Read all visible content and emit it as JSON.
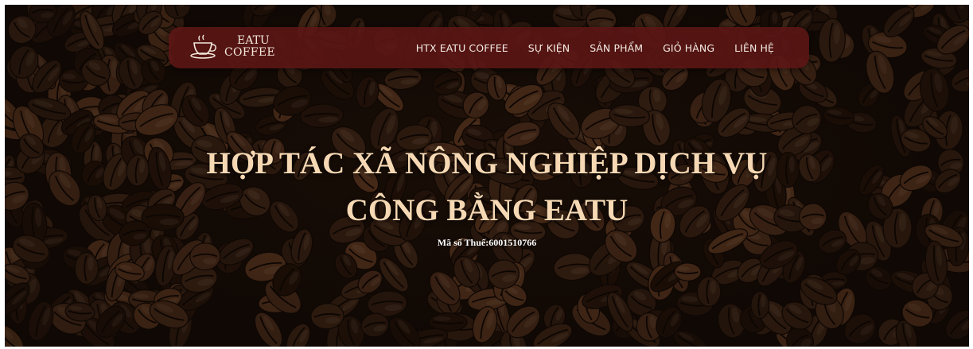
{
  "brand": {
    "line1": "EATU",
    "line2": "COFFEE",
    "logo_icon": "coffee-cup-icon"
  },
  "nav": {
    "items": [
      {
        "label": "HTX EATU COFFEE"
      },
      {
        "label": "SỰ KIỆN"
      },
      {
        "label": "SẢN PHẨM"
      },
      {
        "label": "GIỎ HÀNG"
      },
      {
        "label": "LIÊN HỆ"
      }
    ]
  },
  "hero": {
    "title_line1": "HỢP TÁC XÃ NÔNG NGHIỆP DỊCH VỤ",
    "title_line2": "CÔNG BẰNG EATU",
    "tax_label": "Mã số Thuế:6001510766"
  },
  "colors": {
    "navbar_bg": "#5c1614",
    "title": "#f6d9b4",
    "nav_text": "#f4ece4"
  }
}
